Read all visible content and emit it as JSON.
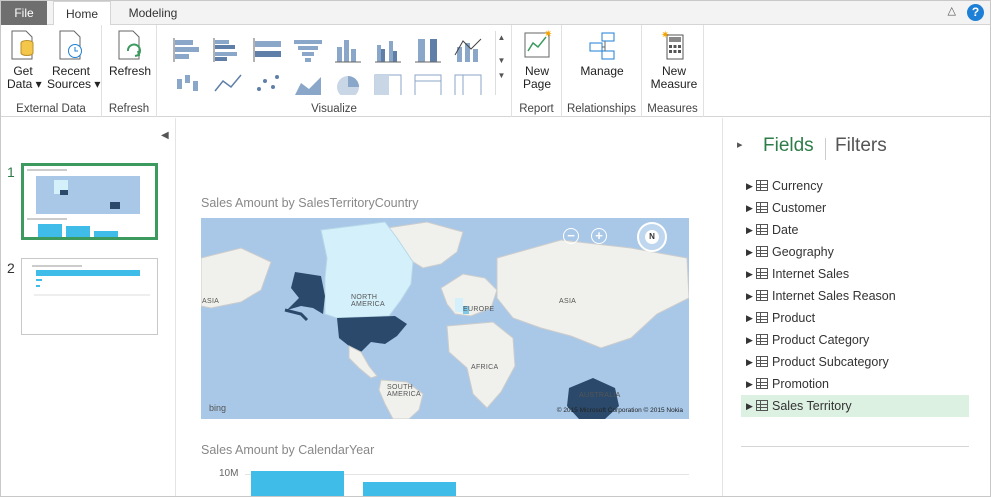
{
  "tabs": {
    "file": "File",
    "home": "Home",
    "modeling": "Modeling"
  },
  "window": {
    "help": "?"
  },
  "ribbon": {
    "get_data": "Get\nData ▾",
    "recent_sources": "Recent\nSources ▾",
    "external_data": "External Data",
    "refresh_button": "Refresh",
    "refresh_group": "Refresh",
    "visualize": "Visualize",
    "new_page": "New\nPage",
    "report": "Report",
    "manage": "Manage",
    "relationships": "Relationships",
    "new_measure": "New\nMeasure",
    "measures": "Measures"
  },
  "pages": {
    "page1": "1",
    "page2": "2"
  },
  "canvas": {
    "map_title": "Sales Amount by SalesTerritoryCountry",
    "map_labels": {
      "asia_left": "ASIA",
      "north_america": "NORTH AMERICA",
      "europe": "EUROPE",
      "asia_right": "ASIA",
      "africa": "AFRICA",
      "south_america": "SOUTH AMERICA",
      "australia": "AUSTRALIA"
    },
    "bing": "bing",
    "copyright": "© 2015 Microsoft Corporation  © 2015 Nokia",
    "compass": "N",
    "zoom_out": "−",
    "zoom_in": "+",
    "bar_title": "Sales Amount by CalendarYear",
    "bar_y_tick": "10M"
  },
  "fields_pane": {
    "fields_tab": "Fields",
    "filters_tab": "Filters",
    "tables": [
      "Currency",
      "Customer",
      "Date",
      "Geography",
      "Internet Sales",
      "Internet Sales Reason",
      "Product",
      "Product Category",
      "Product Subcategory",
      "Promotion",
      "Sales Territory"
    ],
    "selected": "Sales Territory"
  },
  "colors": {
    "accent_green": "#2e7d48",
    "bar_blue": "#3fbce7",
    "map_dark": "#2b4a6b",
    "map_light": "#d4f1fb"
  }
}
